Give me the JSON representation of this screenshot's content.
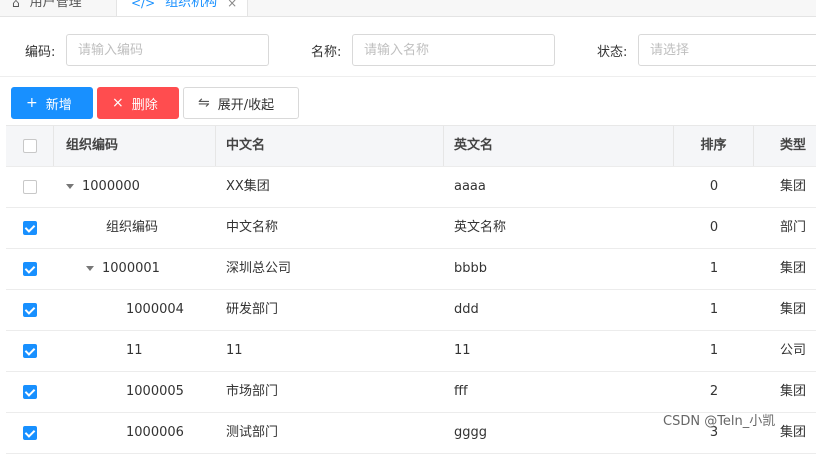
{
  "tabs": [
    {
      "label": "用户管理",
      "icon": "home-icon",
      "active": false
    },
    {
      "label": "组织机构",
      "icon": "code-icon",
      "active": true,
      "close": "×"
    }
  ],
  "search": {
    "code_label": "编码:",
    "code_placeholder": "请输入编码",
    "name_label": "名称:",
    "name_placeholder": "请输入名称",
    "status_label": "状态:",
    "status_placeholder": "请选择"
  },
  "toolbar": {
    "add_label": "新增",
    "add_icon": "+",
    "delete_label": "删除",
    "delete_icon": "×",
    "toggle_label": "展开/收起",
    "toggle_icon": "⇋"
  },
  "table": {
    "columns": [
      "组织编码",
      "中文名",
      "英文名",
      "排序",
      "类型"
    ],
    "rows": [
      {
        "checked": false,
        "expandable": true,
        "level": 0,
        "code": "1000000",
        "cn": "XX集团",
        "en": "aaaa",
        "sort": "0",
        "type": "集团"
      },
      {
        "checked": true,
        "expandable": false,
        "level": 1,
        "code": "组织编码",
        "cn": "中文名称",
        "en": "英文名称",
        "sort": "0",
        "type": "部门"
      },
      {
        "checked": true,
        "expandable": true,
        "level": 1,
        "code": "1000001",
        "cn": "深圳总公司",
        "en": "bbbb",
        "sort": "1",
        "type": "集团"
      },
      {
        "checked": true,
        "expandable": false,
        "level": 2,
        "code": "1000004",
        "cn": "研发部门",
        "en": "ddd",
        "sort": "1",
        "type": "集团"
      },
      {
        "checked": true,
        "expandable": false,
        "level": 2,
        "code": "11",
        "cn": "11",
        "en": "11",
        "sort": "1",
        "type": "公司"
      },
      {
        "checked": true,
        "expandable": false,
        "level": 2,
        "code": "1000005",
        "cn": "市场部门",
        "en": "fff",
        "sort": "2",
        "type": "集团"
      },
      {
        "checked": true,
        "expandable": false,
        "level": 2,
        "code": "1000006",
        "cn": "测试部门",
        "en": "gggg",
        "sort": "3",
        "type": "集团"
      }
    ]
  },
  "watermark": "CSDN @Teln_小凯",
  "colors": {
    "primary": "#1890ff",
    "danger": "#ff4d4f"
  }
}
